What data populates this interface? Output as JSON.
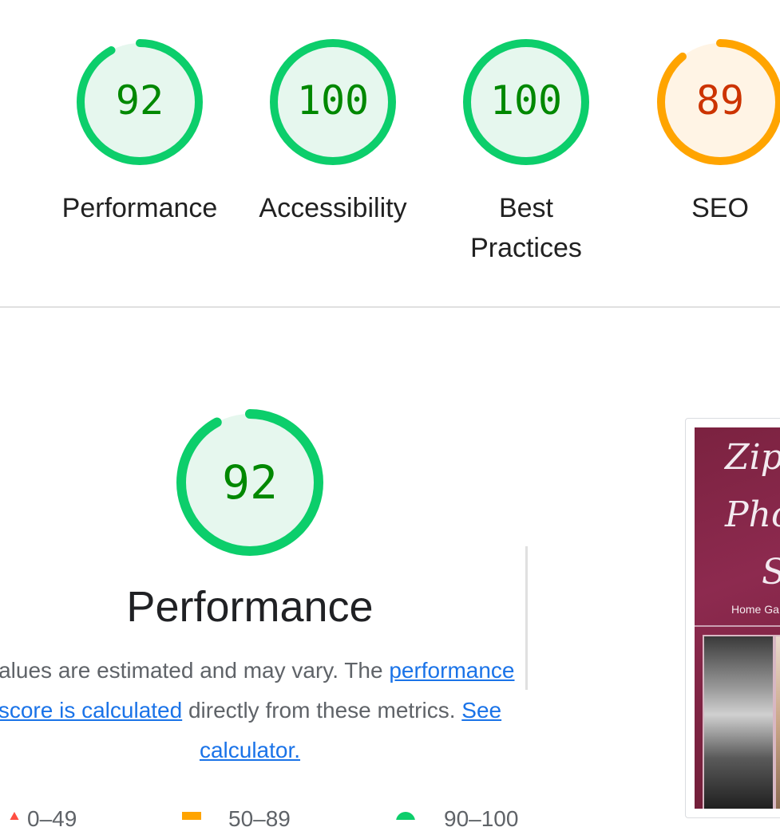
{
  "colors": {
    "pass": "#0cce6b",
    "pass_fill": "#e6f7ee",
    "pass_text": "#008800",
    "average": "#ffa400",
    "average_fill": "#fff4e5",
    "average_text": "#cc3300",
    "link": "#1a73e8"
  },
  "categories": [
    {
      "score": "92",
      "label": "Performance",
      "value": 92,
      "rating": "pass"
    },
    {
      "score": "100",
      "label": "Accessibility",
      "value": 100,
      "rating": "pass"
    },
    {
      "score": "100",
      "label_line1": "Best",
      "label_line2": "Practices",
      "value": 100,
      "rating": "pass"
    },
    {
      "score": "89",
      "label": "SEO",
      "value": 89,
      "rating": "average"
    }
  ],
  "performance": {
    "score": "92",
    "value": 92,
    "title": "Performance",
    "desc_part1": "Values are estimated and may vary. The ",
    "desc_link": "performance score is calculated",
    "desc_part2": " directly from these metrics. ",
    "calc_link": "See calculator.",
    "legend": [
      {
        "range": "0–49",
        "shape": "triangle-icon"
      },
      {
        "range": "50–89",
        "shape": "square-icon"
      },
      {
        "range": "90–100",
        "shape": "circle-icon"
      }
    ]
  },
  "screenshot": {
    "title_line1": "Zip",
    "title_line2": "Phot",
    "title_line3": "S",
    "nav_text": "Home Ga"
  }
}
